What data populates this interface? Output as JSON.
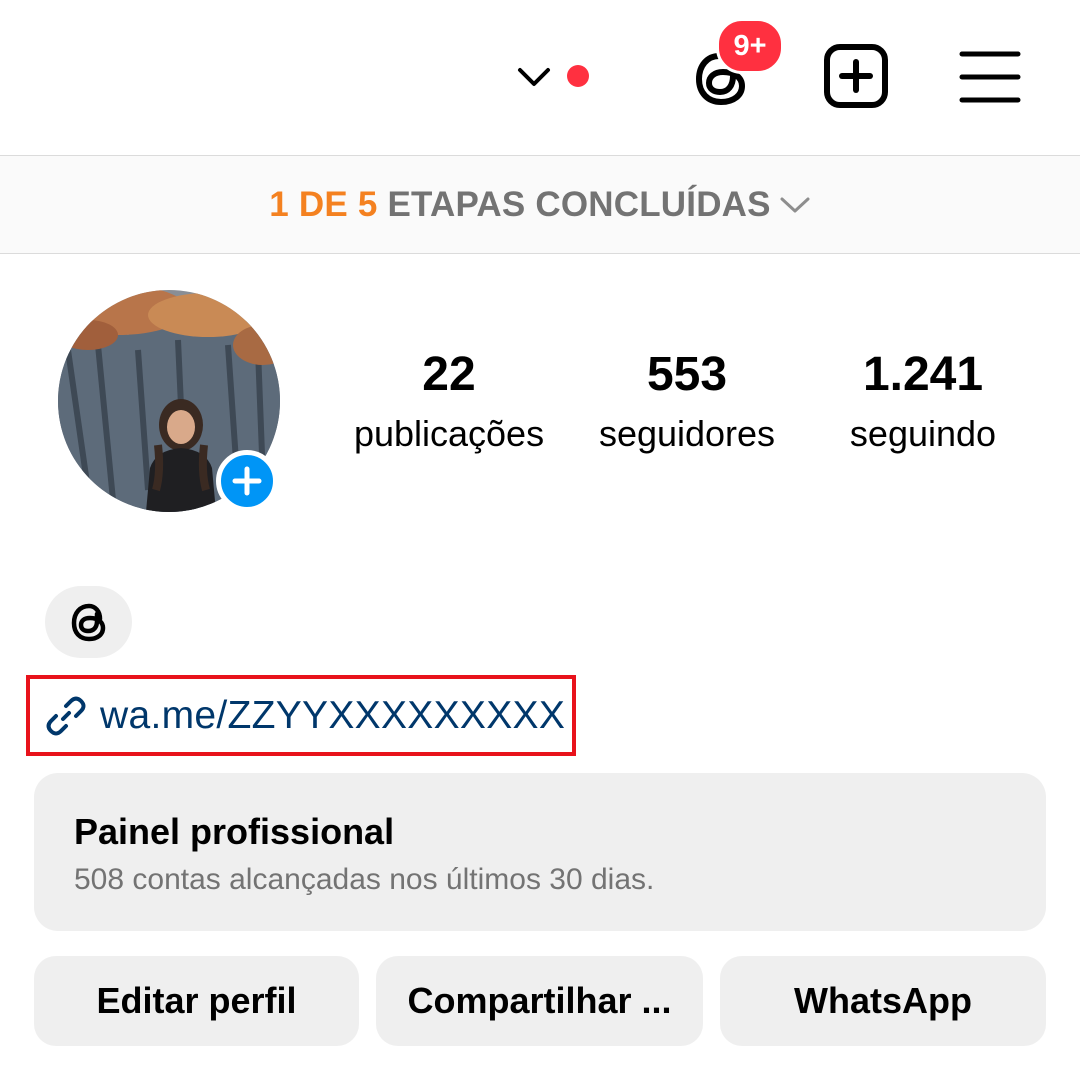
{
  "header": {
    "threads_badge": "9+",
    "icons": {
      "account_switch": "chevron-down-icon",
      "threads": "threads-icon",
      "create": "plus-square-icon",
      "menu": "hamburger-menu-icon"
    },
    "notification_dot_color": "#ff3040"
  },
  "steps_banner": {
    "completed": "1 DE 5",
    "label": "ETAPAS CONCLUÍDAS",
    "accent_color": "#f48120"
  },
  "profile": {
    "stats": [
      {
        "value": "22",
        "label": "publicações"
      },
      {
        "value": "553",
        "label": "seguidores"
      },
      {
        "value": "1.241",
        "label": "seguindo"
      }
    ],
    "link": "wa.me/ZZYYXXXXXXXXX"
  },
  "dashboard": {
    "title": "Painel profissional",
    "subtitle": "508 contas alcançadas nos últimos 30 dias."
  },
  "actions": {
    "edit": "Editar perfil",
    "share": "Compartilhar ...",
    "whatsapp": "WhatsApp"
  }
}
